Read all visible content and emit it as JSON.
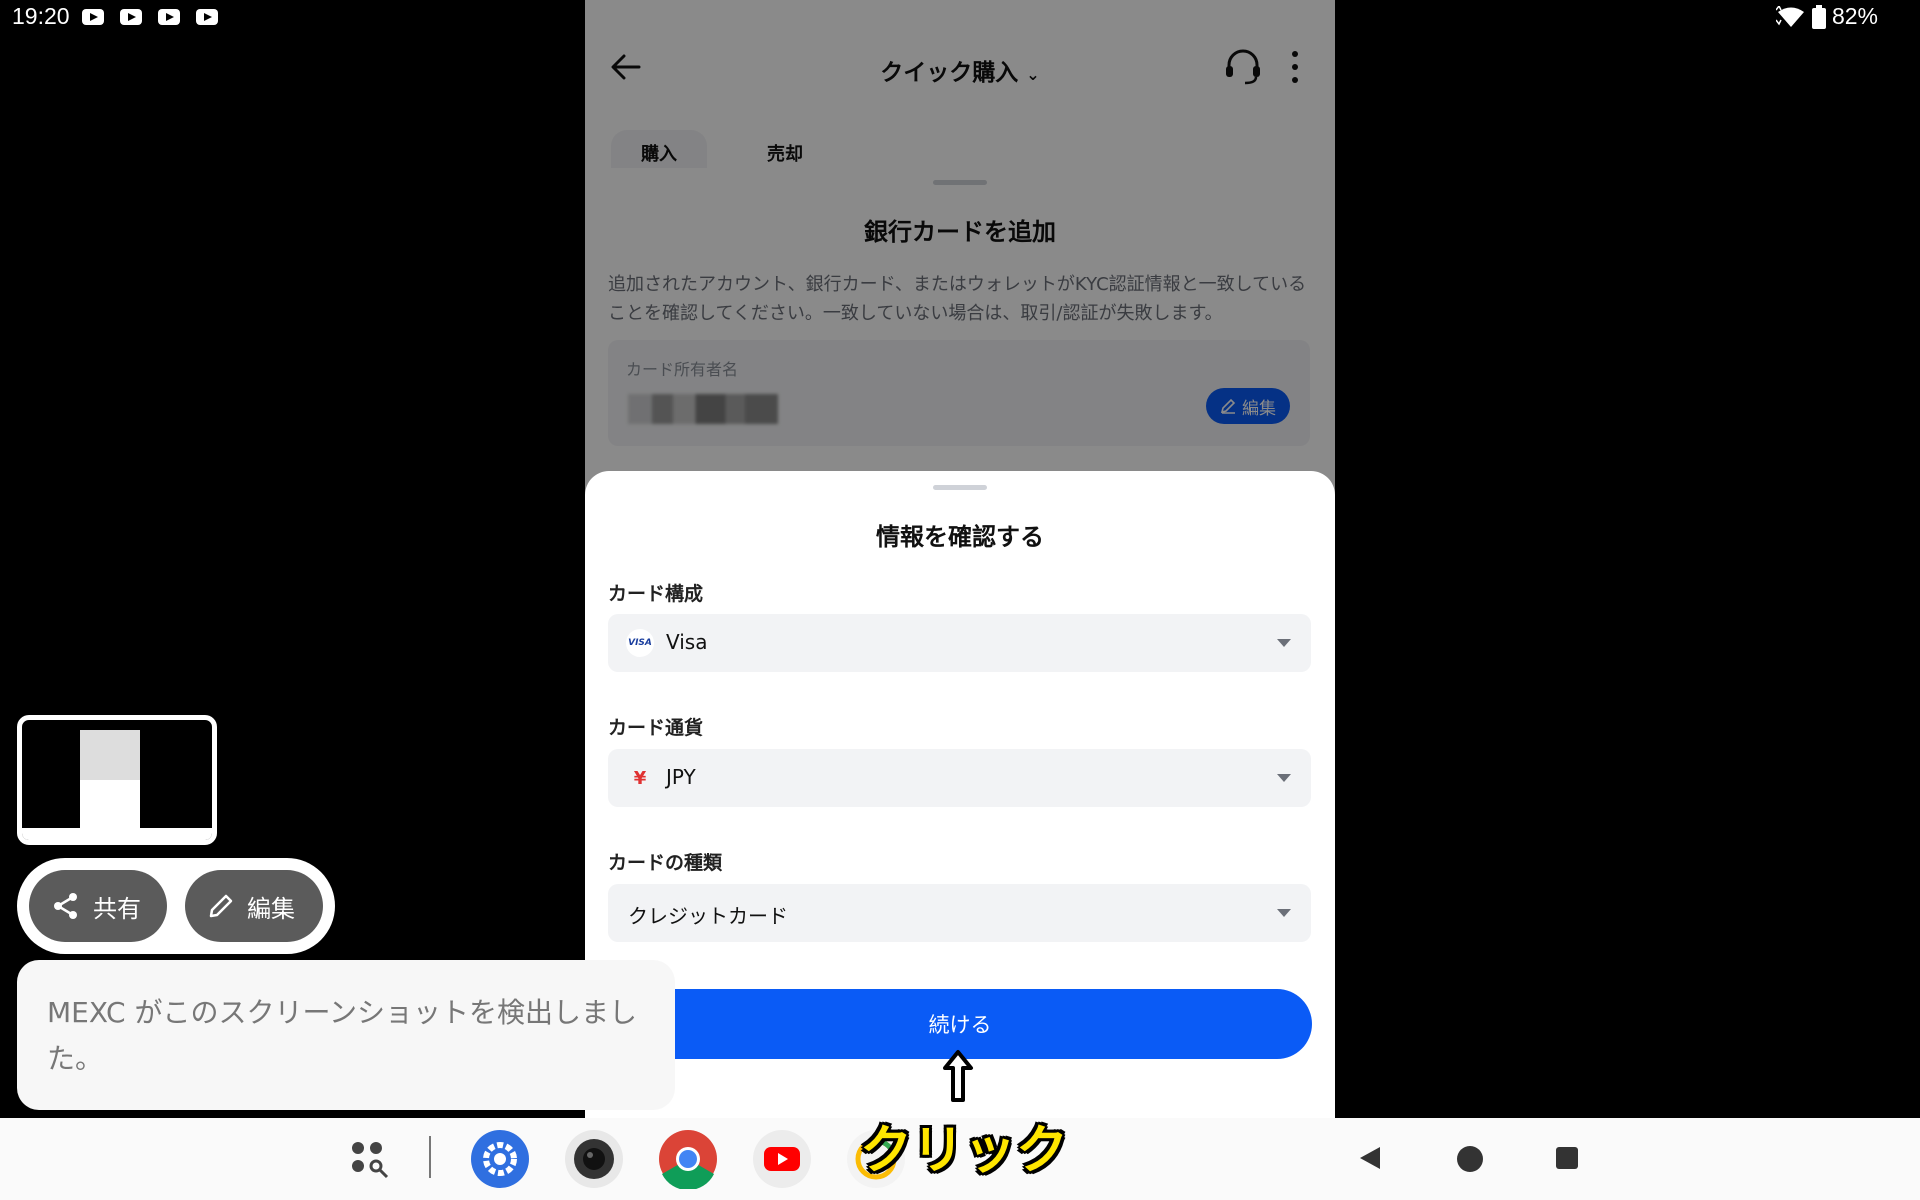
{
  "status_bar": {
    "time": "19:20",
    "battery": "82%"
  },
  "app": {
    "title": "クイック購入",
    "tabs": [
      "購入",
      "売却"
    ]
  },
  "add_card_sheet": {
    "title": "銀行カードを追加",
    "description": "追加されたアカウント、銀行カード、またはウォレットがKYC認証情報と一致していることを確認してください。一致していない場合は、取引/認証が失敗します。",
    "holder_label": "カード所有者名",
    "edit_label": "編集"
  },
  "confirm_sheet": {
    "title": "情報を確認する",
    "card_scheme_label": "カード構成",
    "card_scheme_value": "Visa",
    "card_scheme_badge": "VISA",
    "currency_label": "カード通貨",
    "currency_value": "JPY",
    "currency_symbol": "¥",
    "card_type_label": "カードの種類",
    "card_type_value": "クレジットカード",
    "continue_label": "続ける"
  },
  "annotation": {
    "label": "クリック"
  },
  "screenshot_ui": {
    "share_label": "共有",
    "edit_label": "編集",
    "toast": "MEXC がこのスクリーンショットを検出しました。"
  },
  "taskbar": {
    "apps": [
      "settings-icon",
      "camera-icon",
      "chrome-icon",
      "youtube-icon",
      "photos-icon"
    ]
  },
  "colors": {
    "accent": "#0a5bf6",
    "annotation": "#ffe600"
  }
}
